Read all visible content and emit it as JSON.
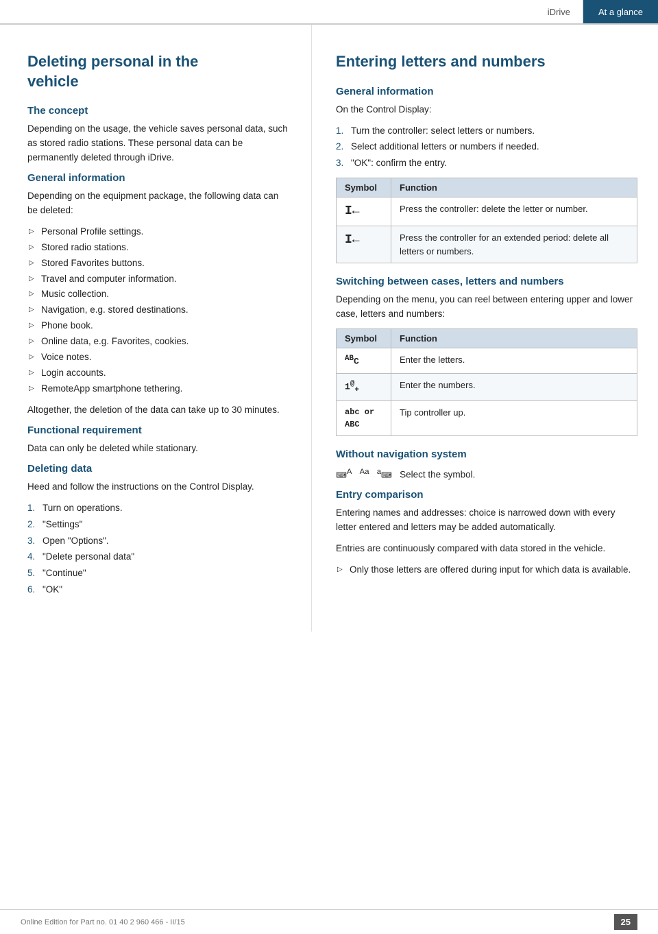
{
  "header": {
    "idrive_label": "iDrive",
    "at_a_glance_label": "At a glance"
  },
  "left": {
    "page_title_line1": "Deleting personal in the",
    "page_title_line2": "vehicle",
    "sections": [
      {
        "id": "the-concept",
        "heading": "The concept",
        "body": "Depending on the usage, the vehicle saves personal data, such as stored radio stations. These personal data can be permanently deleted through iDrive."
      },
      {
        "id": "general-information",
        "heading": "General information",
        "body": "Depending on the equipment package, the following data can be deleted:",
        "bullets": [
          "Personal Profile settings.",
          "Stored radio stations.",
          "Stored Favorites buttons.",
          "Travel and computer information.",
          "Music collection.",
          "Navigation, e.g. stored destinations.",
          "Phone book.",
          "Online data, e.g. Favorites, cookies.",
          "Voice notes.",
          "Login accounts.",
          "RemoteApp smartphone tethering."
        ],
        "body2": "Altogether, the deletion of the data can take up to 30 minutes."
      },
      {
        "id": "functional-requirement",
        "heading": "Functional requirement",
        "body": "Data can only be deleted while stationary."
      },
      {
        "id": "deleting-data",
        "heading": "Deleting data",
        "body": "Heed and follow the instructions on the Control Display.",
        "steps": [
          "Turn on operations.",
          "\"Settings\"",
          "Open \"Options\".",
          "\"Delete personal data\"",
          "\"Continue\"",
          "\"OK\""
        ]
      }
    ]
  },
  "right": {
    "page_title": "Entering letters and numbers",
    "sections": [
      {
        "id": "general-info-right",
        "heading": "General information",
        "body": "On the Control Display:",
        "steps": [
          "Turn the controller: select letters or numbers.",
          "Select additional letters or numbers if needed.",
          "\"OK\": confirm the entry."
        ],
        "table": {
          "headers": [
            "Symbol",
            "Function"
          ],
          "rows": [
            {
              "symbol": "I←",
              "function": "Press the controller: delete the letter or number."
            },
            {
              "symbol": "I←",
              "function": "Press the controller for an extended period: delete all letters or numbers."
            }
          ]
        }
      },
      {
        "id": "switching-cases",
        "heading": "Switching between cases, letters and numbers",
        "body": "Depending on the menu, you can reel between entering upper and lower case, letters and numbers:",
        "table": {
          "headers": [
            "Symbol",
            "Function"
          ],
          "rows": [
            {
              "symbol": "ᴬᴮC",
              "function": "Enter the letters."
            },
            {
              "symbol": "1@₊",
              "function": "Enter the numbers."
            },
            {
              "symbol": "abc or ABC",
              "function": "Tip controller up."
            }
          ]
        }
      },
      {
        "id": "without-navigation",
        "heading": "Without navigation system",
        "body": "⌨ᴬ  ᴬᵃ  ᵃ⌨  Select the symbol."
      },
      {
        "id": "entry-comparison",
        "heading": "Entry comparison",
        "body1": "Entering names and addresses: choice is narrowed down with every letter entered and letters may be added automatically.",
        "body2": "Entries are continuously compared with data stored in the vehicle.",
        "bullets": [
          "Only those letters are offered during input for which data is available."
        ]
      }
    ]
  },
  "footer": {
    "text": "Online Edition for Part no. 01 40 2 960 466 - II/15",
    "page_number": "25"
  }
}
